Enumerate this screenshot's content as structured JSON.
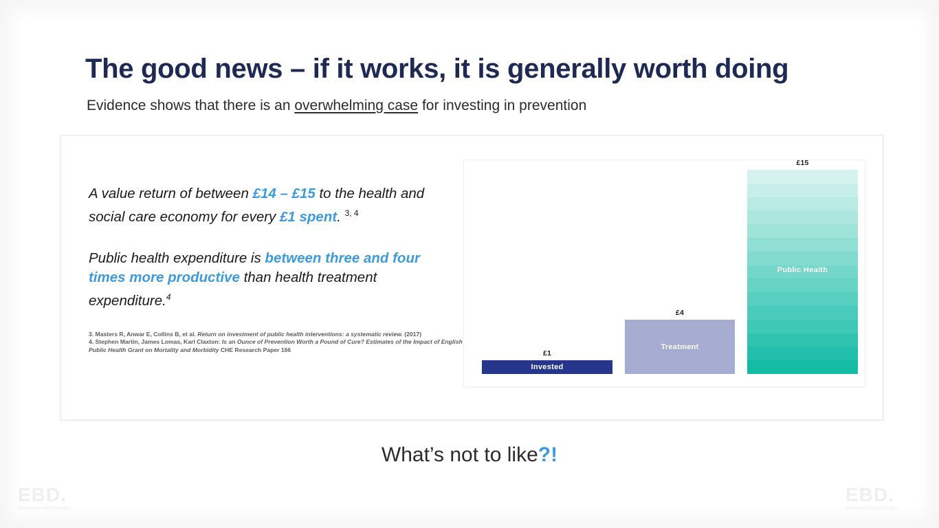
{
  "slide": {
    "title": "The good news – if it works, it is generally worth doing",
    "subtitle": {
      "before": "Evidence shows that there is an ",
      "underlined": "overwhelming case",
      "after": " for investing in prevention"
    },
    "closing": {
      "text": "What’s not to like",
      "accent": "?!"
    }
  },
  "left_column": {
    "paragraph_1": {
      "part_1": "A value return of between ",
      "highlight_1": "£14 – £15",
      "part_2": " to the health and social care economy for every ",
      "highlight_2": "£1 spent",
      "part_3": ".",
      "superscript": "3, 4"
    },
    "paragraph_2": {
      "part_1": "Public health expenditure is ",
      "highlight_1": "between three and four times more productive",
      "part_2": " than health treatment expenditure.",
      "superscript": "4"
    }
  },
  "footnotes": [
    {
      "prefix": "3. Masters R, Anwar E, Collins B, et al. ",
      "italic": "Return on investment of public health interventions: a systematic review.",
      "suffix": " (2017)"
    },
    {
      "prefix": "4. Stephen Martin, James Lomas, Karl Claxton: ",
      "italic": "Is an Ounce of Prevention Worth a Pound of Cure? Estimates of the Impact of English Public Health Grant on Mortality and Morbidity",
      "suffix": " CHE Research Paper 166"
    }
  ],
  "chart_data": {
    "type": "bar",
    "title": "",
    "xlabel": "",
    "ylabel": "",
    "ylim": [
      0,
      15
    ],
    "grid": false,
    "legend": "none",
    "categories": [
      "Invested",
      "Treatment",
      "Public Health"
    ],
    "values": [
      1,
      4,
      15
    ],
    "value_labels": [
      "£1",
      "£4",
      "£15"
    ],
    "bars": [
      {
        "label": "Invested",
        "value": 1,
        "value_label": "£1",
        "color": "#25368C",
        "style": "solid"
      },
      {
        "label": "Treatment",
        "value": 4,
        "value_label": "£4",
        "color": "#A7ADD2",
        "style": "solid"
      },
      {
        "label": "Public Health",
        "value": 15,
        "value_label": "£15",
        "color": "#17BDA8",
        "style": "banded-gradient",
        "gradient_top": "#D6F2EE",
        "gradient_bottom": "#14BCA6",
        "band_count": 15
      }
    ]
  },
  "colors": {
    "title_navy": "#1F2A54",
    "accent_blue": "#3D9BDC",
    "bar_invested": "#25368C",
    "bar_treatment": "#A7ADD2",
    "bar_public_health": "#17BDA8",
    "body_text": "#1A1A1A",
    "footnote_text": "#5C5C5C"
  },
  "logo": {
    "mark": "EBD",
    "dot": ".",
    "tagline": "EconomicsByDesign"
  }
}
